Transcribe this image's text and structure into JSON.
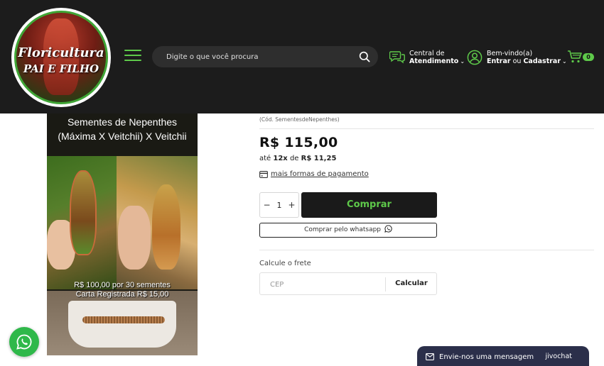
{
  "header": {
    "logo_line1": "Floricultura",
    "logo_line2": "PAI E FILHO",
    "search_placeholder": "Digite o que você procura",
    "support": {
      "line1": "Central de",
      "line2": "Atendimento"
    },
    "account": {
      "line1": "Bem-vindo(a)",
      "line2_enter": "Entrar",
      "line2_or": " ou ",
      "line2_register": "Cadastrar"
    },
    "cart_count": "0"
  },
  "product_image": {
    "title_line1": "Sementes de Nepenthes",
    "title_line2": "(Máxima X Veitchii) X Veitchii",
    "caption_line1": "R$ 100,00 por 30 sementes",
    "caption_line2": "Carta Registrada R$ 15,00"
  },
  "product": {
    "sku": "(Cód. SementesdeNepenthes)",
    "price": "R$ 115,00",
    "installment_prefix": "até ",
    "installment_count": "12x",
    "installment_mid": " de ",
    "installment_value": "R$ 11,25",
    "payments_link": "mais formas de pagamento",
    "qty_minus": "−",
    "qty_value": "1",
    "qty_plus": "+",
    "buy_label": "Comprar",
    "whatsapp_buy_label": "Comprar pelo whatsapp"
  },
  "shipping": {
    "label": "Calcule o frete",
    "cep_placeholder": "CEP",
    "calc_label": "Calcular"
  },
  "chat": {
    "message": "Envie-nos uma mensagem",
    "brand": "jivochat"
  },
  "colors": {
    "accent": "#5ec94a",
    "header_bg": "#1c1c1c",
    "buy_bg": "#1a1a1a",
    "whatsapp": "#2fb84a",
    "chat_bg": "#2b2f4a"
  }
}
